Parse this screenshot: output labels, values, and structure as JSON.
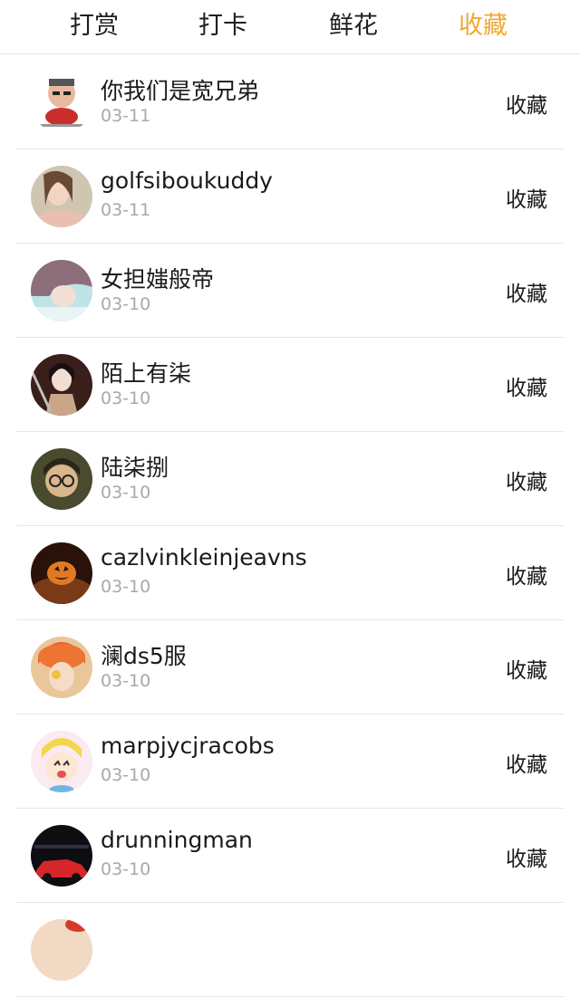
{
  "tabs": [
    {
      "label": "打赏"
    },
    {
      "label": "打卡"
    },
    {
      "label": "鲜花"
    },
    {
      "label": "收藏"
    }
  ],
  "active_tab": 3,
  "accent_color": "#f0a830",
  "list": {
    "items": [
      {
        "name": "你我们是宽兄弟",
        "date": "03-11",
        "action": "收藏",
        "avatar_icon": "cartoon-man-avatar"
      },
      {
        "name": "golfsiboukuddy",
        "date": "03-11",
        "action": "收藏",
        "avatar_icon": "woman-photo-avatar"
      },
      {
        "name": "女担媸般帝",
        "date": "03-10",
        "action": "收藏",
        "avatar_icon": "girl-anime-avatar"
      },
      {
        "name": "陌上有柒",
        "date": "03-10",
        "action": "收藏",
        "avatar_icon": "warrior-anime-avatar"
      },
      {
        "name": "陆柒捌",
        "date": "03-10",
        "action": "收藏",
        "avatar_icon": "glasses-anime-avatar"
      },
      {
        "name": "cazlvinkleinjeavns",
        "date": "03-10",
        "action": "收藏",
        "avatar_icon": "pumpkin-avatar"
      },
      {
        "name": "澜ds5服",
        "date": "03-10",
        "action": "收藏",
        "avatar_icon": "orange-hat-girl-avatar"
      },
      {
        "name": "marpjycjracobs",
        "date": "03-10",
        "action": "收藏",
        "avatar_icon": "blonde-cartoon-avatar"
      },
      {
        "name": "drunningman",
        "date": "03-10",
        "action": "收藏",
        "avatar_icon": "red-car-avatar"
      }
    ]
  }
}
